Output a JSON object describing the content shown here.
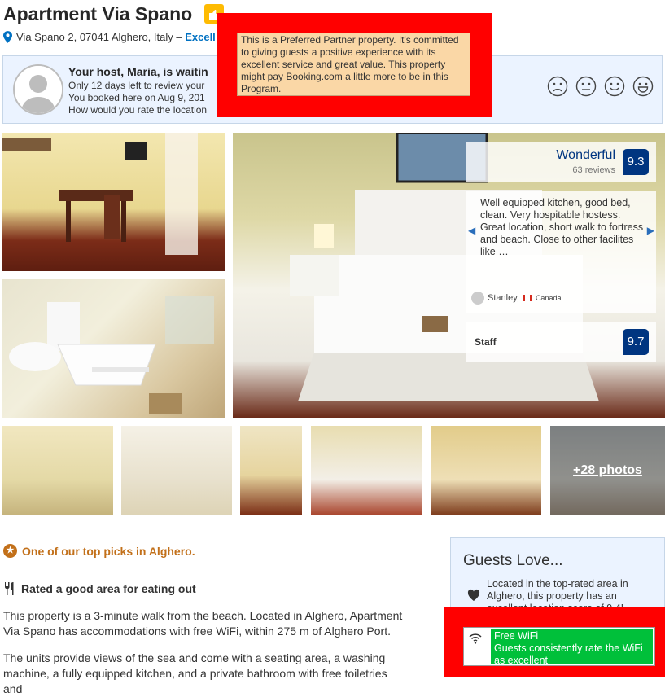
{
  "property": {
    "title": "Apartment Via Spano",
    "address": "Via Spano 2, 07041 Alghero, Italy – ",
    "location_link": "Excell"
  },
  "host_prompt": {
    "title": "Your host, Maria, is waitin",
    "line1": "Only 12 days left to review your",
    "line2": "You booked here on Aug 9, 201",
    "line3": "How would you rate the location",
    "face_icons": [
      "very-sad-face-icon",
      "neutral-face-icon",
      "happy-face-icon",
      "very-happy-face-icon"
    ]
  },
  "tooltip": {
    "text": "This is a Preferred Partner property. It's committed to giving guests a positive experience with its excellent service and great value. This property might pay Booking.com a little more to be in this Program."
  },
  "gallery": {
    "more_photos": "+28 photos"
  },
  "score": {
    "word": "Wonderful",
    "reviews": "63 reviews",
    "value": "9.3"
  },
  "review": {
    "text": "Well equipped kitchen, good bed, clean. Very hospitable hostess. Great location, short walk to fortress and beach. Close to other facilites like …",
    "reviewer": "Stanley,",
    "country": "Canada"
  },
  "staff": {
    "label": "Staff",
    "value": "9.7"
  },
  "highlights": {
    "top_pick": "One of our top picks in Alghero.",
    "eating": "Rated a good area for eating out"
  },
  "description": {
    "p1": "This property is a 3-minute walk from the beach. Located in Alghero, Apartment Via Spano has accommodations with free WiFi, within 275 m of Alghero Port.",
    "p2": "The units provide views of the sea and come with a seating area, a washing machine, a fully equipped kitchen, and a private bathroom with free toiletries and"
  },
  "guests_love": {
    "title": "Guests Love...",
    "location_text": "Located in the top-rated area in Alghero, this property has an excellent location score of 9.4!",
    "wifi_title": "Free WiFi",
    "wifi_text": "Guests consistently rate the WiFi as excellent"
  },
  "colors": {
    "brand_blue": "#003580",
    "link_blue": "#0071c2",
    "badge_yellow": "#febb02",
    "highlight_red": "#ff0000",
    "wifi_green": "#00c03a"
  }
}
